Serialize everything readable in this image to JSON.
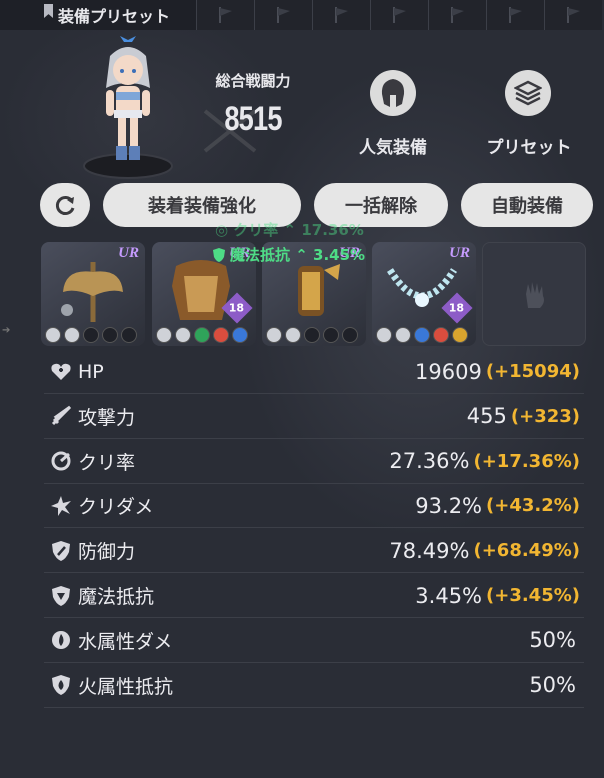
{
  "tab": {
    "title": "装備プリセット",
    "flag_count": 7
  },
  "header": {
    "power_label": "総合戦闘力",
    "power_value": "8515",
    "popular_label": "人気装備",
    "preset_label": "プリセット"
  },
  "buttons": {
    "enhance": "装着装備強化",
    "unequip_all": "一括解除",
    "auto_equip": "自動装備"
  },
  "gear": [
    {
      "rarity": "UR",
      "item": "axe"
    },
    {
      "rarity": "UR",
      "item": "armor",
      "level": "18"
    },
    {
      "rarity": "UR",
      "item": "gauntlet"
    },
    {
      "rarity": "UR",
      "item": "necklace",
      "level": "18"
    }
  ],
  "floating_tips": {
    "faded": "◎ クリ率 ⌃ 17.36%",
    "main": "魔法抵抗 ⌃ 3.45%"
  },
  "stats": [
    {
      "icon": "heart-plus-icon",
      "label": "HP",
      "value": "19609",
      "bonus": "(+15094)"
    },
    {
      "icon": "sword-icon",
      "label": "攻撃力",
      "value": "455",
      "bonus": "(+323)"
    },
    {
      "icon": "crit-rate-icon",
      "label": "クリ率",
      "value": "27.36%",
      "bonus": "(+17.36%)"
    },
    {
      "icon": "crit-damage-icon",
      "label": "クリダメ",
      "value": "93.2%",
      "bonus": "(+43.2%)"
    },
    {
      "icon": "shield-icon",
      "label": "防御力",
      "value": "78.49%",
      "bonus": "(+68.49%)"
    },
    {
      "icon": "magic-shield-icon",
      "label": "魔法抵抗",
      "value": "3.45%",
      "bonus": "(+3.45%)"
    },
    {
      "icon": "water-icon",
      "label": "水属性ダメ",
      "value": "50%",
      "bonus": ""
    },
    {
      "icon": "fire-shield-icon",
      "label": "火属性抵抗",
      "value": "50%",
      "bonus": ""
    }
  ],
  "colors": {
    "bonus": "#f2b632",
    "tip": "#4edc86",
    "ur": "#c69cff"
  }
}
